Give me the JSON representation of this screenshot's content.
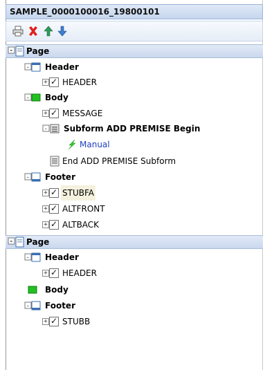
{
  "window": {
    "title": "SAMPLE_0000100016_19800101"
  },
  "toolbar": {
    "buttons": [
      {
        "name": "print-icon"
      },
      {
        "name": "delete-icon"
      },
      {
        "name": "move-up-icon"
      },
      {
        "name": "move-down-icon"
      }
    ]
  },
  "tree": {
    "page1": {
      "label": "Page",
      "header": {
        "label": "Header",
        "items": [
          "HEADER"
        ]
      },
      "body": {
        "label": "Body",
        "message": "MESSAGE",
        "subform_begin": "Subform ADD PREMISE Begin",
        "manual": "Manual",
        "subform_end": "End ADD PREMISE Subform"
      },
      "footer": {
        "label": "Footer",
        "items": [
          "STUBFA",
          "ALTFRONT",
          "ALTBACK"
        ]
      }
    },
    "page2": {
      "label": "Page",
      "header": {
        "label": "Header",
        "items": [
          "HEADER"
        ]
      },
      "body": {
        "label": "Body"
      },
      "footer": {
        "label": "Footer",
        "items": [
          "STUBB"
        ]
      }
    }
  },
  "colors": {
    "accent": "#c5d6ee",
    "body_icon": "#22c022",
    "link": "#1f3fbf",
    "delete": "#e0201b",
    "arrow": "#2f9a5a"
  }
}
